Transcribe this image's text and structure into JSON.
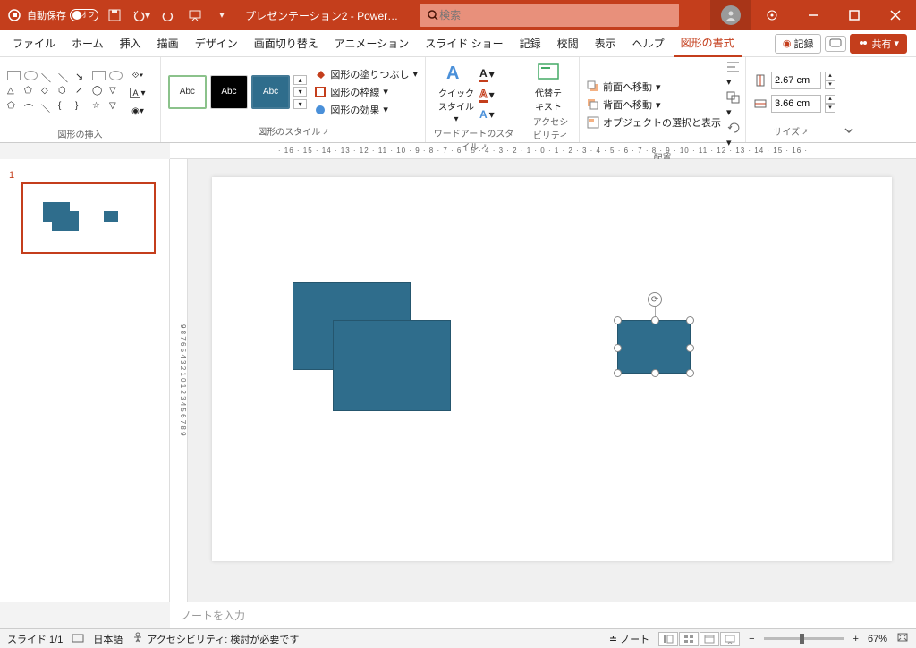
{
  "titlebar": {
    "autosave_label": "自動保存",
    "autosave_state": "オフ",
    "doc_title": "プレゼンテーション2 - Power…",
    "search_placeholder": "検索"
  },
  "tabs": {
    "file": "ファイル",
    "home": "ホーム",
    "insert": "挿入",
    "draw": "描画",
    "design": "デザイン",
    "transitions": "画面切り替え",
    "animations": "アニメーション",
    "slideshow": "スライド ショー",
    "record": "記録",
    "review": "校閲",
    "view": "表示",
    "help": "ヘルプ",
    "shapeformat": "図形の書式",
    "rec_btn": "記録",
    "share_btn": "共有"
  },
  "ribbon": {
    "insert_shapes": "図形の挿入",
    "style_label": "図形のスタイル",
    "fill": "図形の塗りつぶし",
    "outline": "図形の枠線",
    "effects": "図形の効果",
    "abc": "Abc",
    "quickstyle": "クイック\nスタイル",
    "wordart": "ワードアートのスタイル",
    "alttext": "代替テ\nキスト",
    "acc": "アクセシビリティ",
    "bringfwd": "前面へ移動",
    "sendback": "背面へ移動",
    "selection": "オブジェクトの選択と表示",
    "arrange": "配置",
    "height": "2.67 cm",
    "width": "3.66 cm",
    "size": "サイズ"
  },
  "notes_placeholder": "ノートを入力",
  "status": {
    "slide": "スライド 1/1",
    "lang": "日本語",
    "acc": "アクセシビリティ: 検討が必要です",
    "notes_btn": "ノート",
    "zoom": "67%"
  },
  "slide_index": "1"
}
